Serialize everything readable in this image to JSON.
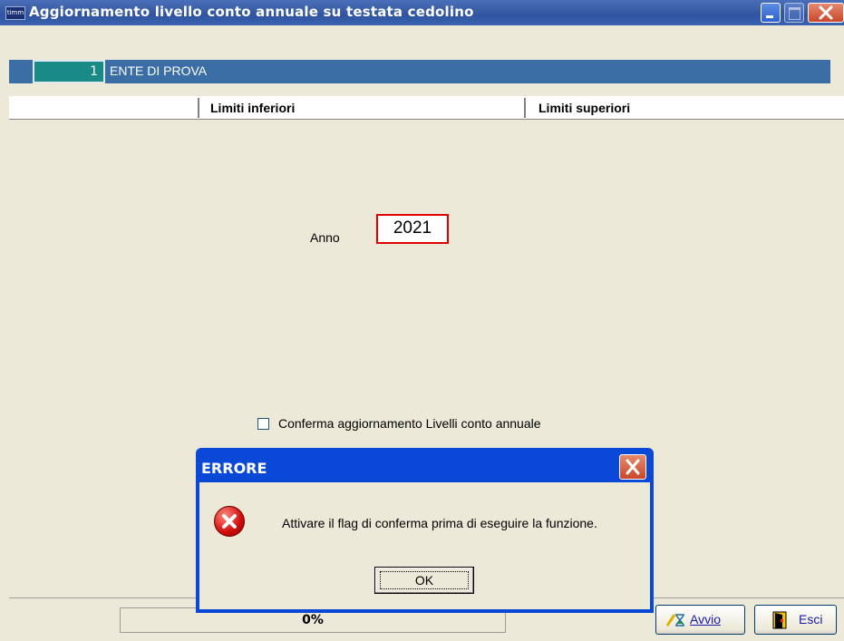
{
  "window": {
    "title": "Aggiornamento livello conto annuale su testata cedolino",
    "app_icon_text": "timm"
  },
  "entity": {
    "code": "1",
    "name": "ENTE DI PROVA"
  },
  "table_header": {
    "lower_limits": "Limiti inferiori",
    "upper_limits": "Limiti superiori"
  },
  "form": {
    "anno_label": "Anno",
    "anno_value": "2021",
    "confirm_label": "Conferma aggiornamento Livelli conto annuale",
    "confirm_checked": false
  },
  "status": {
    "progress_text": "0%",
    "progress_fraction": 0
  },
  "buttons": {
    "avvio": "Avvio",
    "esci": "Esci"
  },
  "dialog": {
    "title": "ERRORE",
    "message": "Attivare il flag di conferma prima di eseguire la funzione.",
    "ok_label": "OK",
    "icon": "error-icon"
  },
  "colors": {
    "titlebar": "#3a5ea6",
    "entity_bar": "#3a6ea5",
    "error_border": "#e00000",
    "dialog_frame": "#0a49d8"
  }
}
